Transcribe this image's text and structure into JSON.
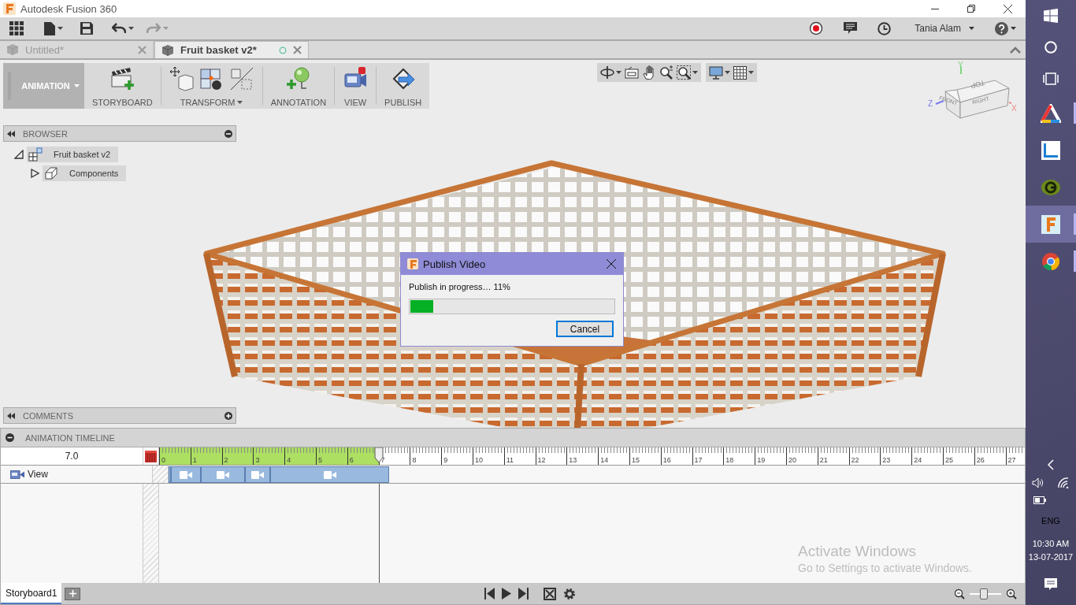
{
  "window": {
    "title": "Autodesk Fusion 360"
  },
  "toolbar": {
    "user": "Tania Alam"
  },
  "document_tabs": [
    {
      "label": "Untitled*",
      "selected": false
    },
    {
      "label": "Fruit basket v2*",
      "selected": true
    }
  ],
  "ribbon": {
    "workspace": "ANIMATION",
    "groups": [
      {
        "kind": "storyboard",
        "label": "STORYBOARD",
        "dropdown": false
      },
      {
        "kind": "transform",
        "label": "TRANSFORM",
        "dropdown": true
      },
      {
        "kind": "annotation",
        "label": "ANNOTATION",
        "dropdown": false
      },
      {
        "kind": "view",
        "label": "VIEW",
        "dropdown": false
      },
      {
        "kind": "publish",
        "label": "PUBLISH",
        "dropdown": false
      }
    ]
  },
  "browser": {
    "title": "BROWSER",
    "tree": [
      {
        "label": "Fruit basket v2",
        "expanded": true,
        "children": [
          {
            "label": "Components",
            "expanded": false
          }
        ]
      }
    ]
  },
  "view_cube": {
    "top": "TOP",
    "front": "FRONT",
    "right": "RIGHT",
    "axis_x": "X",
    "axis_y": "Y",
    "axis_z": "Z"
  },
  "comments": {
    "title": "COMMENTS"
  },
  "dialog": {
    "title": "Publish Video",
    "message": "Publish in progress… 11%",
    "progress": {
      "level": 0.11
    },
    "button": "Cancel"
  },
  "timeline": {
    "title": "ANIMATION TIMELINE",
    "current_time": "7.0",
    "ruler": [
      {
        "text": "0",
        "played": true
      },
      {
        "text": "1",
        "played": true
      },
      {
        "text": "2",
        "played": true
      },
      {
        "text": "3",
        "played": true
      },
      {
        "text": "4",
        "played": true
      },
      {
        "text": "5",
        "played": true
      },
      {
        "text": "6",
        "played": true
      },
      {
        "text": "7",
        "played": false
      },
      {
        "text": "8",
        "played": false
      },
      {
        "text": "9",
        "played": false
      },
      {
        "text": "10",
        "played": false
      },
      {
        "text": "11",
        "played": false
      },
      {
        "text": "12",
        "played": false
      },
      {
        "text": "13",
        "played": false
      },
      {
        "text": "14",
        "played": false
      },
      {
        "text": "15",
        "played": false
      },
      {
        "text": "16",
        "played": false
      },
      {
        "text": "17",
        "played": false
      },
      {
        "text": "18",
        "played": false
      },
      {
        "text": "19",
        "played": false
      },
      {
        "text": "20",
        "played": false
      },
      {
        "text": "21",
        "played": false
      },
      {
        "text": "22",
        "played": false
      },
      {
        "text": "23",
        "played": false
      },
      {
        "text": "24",
        "played": false
      },
      {
        "text": "25",
        "played": false
      },
      {
        "text": "26",
        "played": false
      },
      {
        "text": "27",
        "played": false
      }
    ],
    "tracks": [
      {
        "label": "View"
      }
    ],
    "storyboards": [
      {
        "label": "Storyboard1",
        "selected": true
      }
    ],
    "zoom_slider": {
      "level": 0.45
    }
  },
  "activation_notice": {
    "title": "Activate Windows",
    "text": "Go to Settings to activate Windows."
  },
  "taskbar": {
    "apps": [
      {
        "kind": "triad",
        "running": true,
        "active": false
      },
      {
        "kind": "square",
        "running": false,
        "active": false
      },
      {
        "kind": "g-logo",
        "running": false,
        "active": false
      },
      {
        "kind": "fusion",
        "running": true,
        "active": true
      },
      {
        "kind": "browser",
        "running": true,
        "active": false
      }
    ],
    "language": "ENG",
    "time": "10:30 AM",
    "date": "13-07-2017"
  }
}
